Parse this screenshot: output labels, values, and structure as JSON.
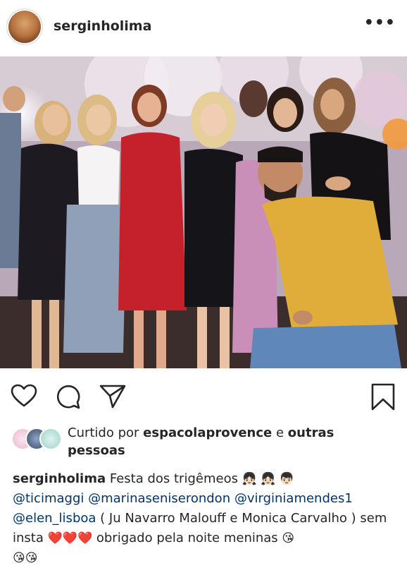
{
  "post": {
    "username": "serginholima",
    "more_label": "•••"
  },
  "icons": {
    "more": "more-options-icon",
    "like": "heart-icon",
    "comment": "comment-icon",
    "share": "send-icon",
    "save": "bookmark-icon"
  },
  "likes": {
    "prefix": "Curtido por",
    "liker": "espacolaprovence",
    "joiner": "e",
    "others": "outras pessoas"
  },
  "caption": {
    "author": "serginholima",
    "text1": "Festa dos trigêmeos",
    "emoji1": "👧🏻 👧🏻 👦🏻",
    "mention1": "@ticimaggi",
    "mention2": "@marinaseniserondon",
    "mention3": "@virginiamendes1",
    "mention4": "@elen_lisboa",
    "text2": "( Ju Navarro Malouff e Monica Carvalho ) sem insta",
    "emoji2": "❤️❤️❤️",
    "text3": "obrigado pela noite meninas",
    "emoji3": "😘",
    "emoji4": "😘😘"
  },
  "colors": {
    "text": "#262626",
    "mention": "#003569"
  }
}
